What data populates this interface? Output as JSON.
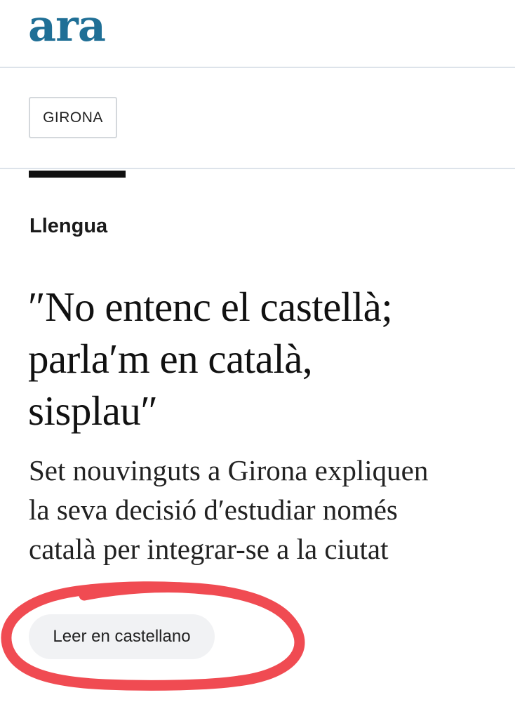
{
  "header": {
    "logo": "ara",
    "brand_color": "#1f6f96"
  },
  "section_nav": {
    "active_tab": "GIRONA"
  },
  "article": {
    "category": "Llengua",
    "headline_lines": [
      "″No entenc el castellà;",
      "parla′m en català,",
      "sisplau″"
    ],
    "subtitle_lines": [
      "Set nouvinguts a Girona expliquen",
      "la seva decisió d′estudiar només",
      "català per integrar-se a la ciutat"
    ],
    "read_in_spanish_label": "Leer en castellano"
  },
  "annotation": {
    "highlight_color": "#f04b52"
  }
}
